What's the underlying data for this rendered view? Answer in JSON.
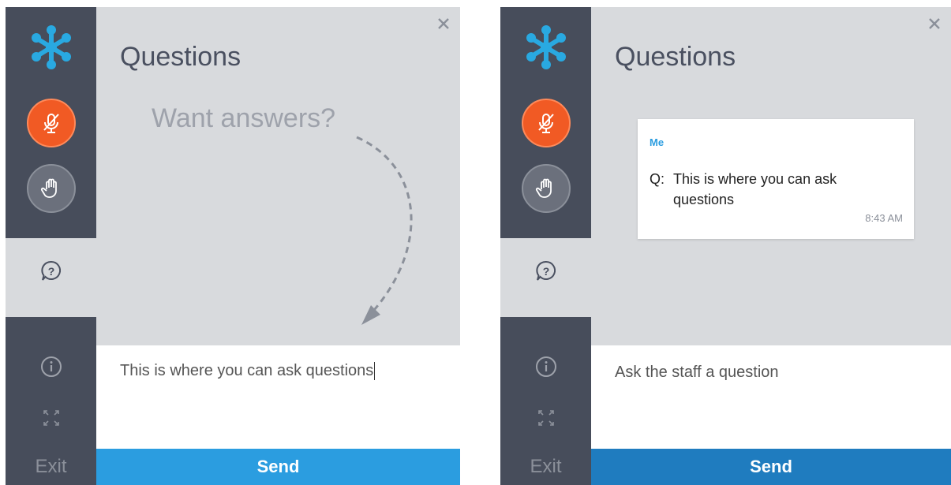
{
  "colors": {
    "sidebar_bg": "#474d5b",
    "content_bg": "#d8dadd",
    "mic_active": "#f15a24",
    "send_button": "#2b9de0",
    "send_button_alt": "#1f7cbf",
    "sender_name": "#2b9de0"
  },
  "sidebar": {
    "icons": [
      "snowflake-logo-icon",
      "microphone-muted-icon",
      "raise-hand-icon",
      "question-bubble-icon",
      "info-icon",
      "expand-icon"
    ],
    "exit_label": "Exit"
  },
  "panel_left": {
    "title": "Questions",
    "hint": "Want answers?",
    "input_value": "This is where you can ask questions",
    "send_label": "Send"
  },
  "panel_right": {
    "title": "Questions",
    "message": {
      "sender": "Me",
      "prefix": "Q:",
      "text": "This is where you can ask questions",
      "time": "8:43 AM"
    },
    "input_placeholder": "Ask the staff a question",
    "send_label": "Send"
  }
}
